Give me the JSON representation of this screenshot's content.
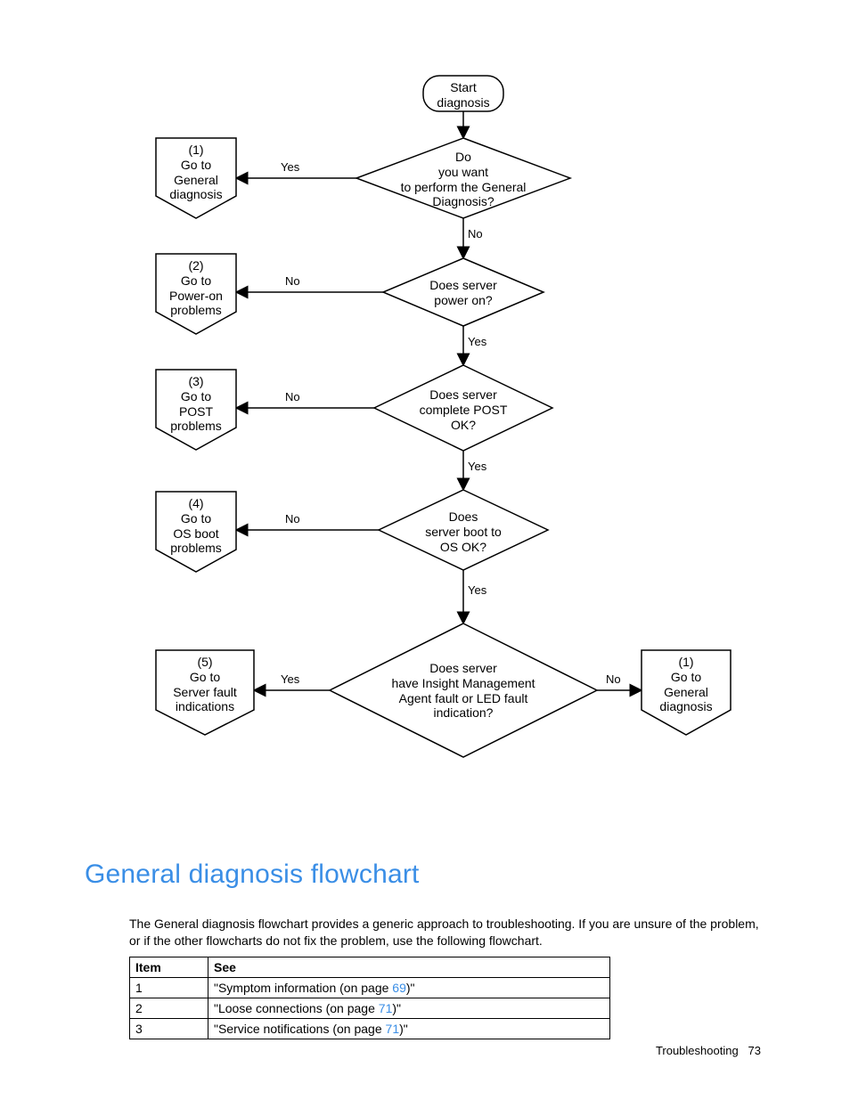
{
  "heading": "General diagnosis flowchart",
  "body_text_1": "The General diagnosis flowchart provides a generic approach to troubleshooting. If you are unsure of the problem, or if the other flowcharts do not fix the problem, use the following flowchart.",
  "footer_section": "Troubleshooting",
  "footer_page": "73",
  "table": {
    "h1": "Item",
    "h2": "See",
    "rows": [
      {
        "item": "1",
        "see_a": "\"Symptom information (on page ",
        "link": "69",
        "see_b": ")\""
      },
      {
        "item": "2",
        "see_a": "\"Loose connections (on page ",
        "link": "71",
        "see_b": ")\""
      },
      {
        "item": "3",
        "see_a": "\"Service notifications (on page ",
        "link": "71",
        "see_b": ")\""
      }
    ]
  },
  "flow": {
    "start": "Start\ndiagnosis",
    "d1": "Do\nyou want\nto perform the General\nDiagnosis?",
    "d2": "Does server\npower on?",
    "d3": "Does server\ncomplete POST\nOK?",
    "d4": "Does\nserver boot to\nOS OK?",
    "d5": "Does server\nhave Insight Management\nAgent fault or LED fault\nindication?",
    "o1": "(1)\nGo to\nGeneral\ndiagnosis",
    "o2": "(2)\nGo to\nPower-on\nproblems",
    "o3": "(3)\nGo to\nPOST\nproblems",
    "o4": "(4)\nGo to\nOS boot\nproblems",
    "o5": "(5)\nGo to\nServer fault\nindications",
    "o1b": "(1)\nGo to\nGeneral\ndiagnosis",
    "yes": "Yes",
    "no": "No"
  },
  "chart_data": {
    "type": "flowchart",
    "nodes": [
      {
        "id": "start",
        "shape": "terminator",
        "text": "Start diagnosis"
      },
      {
        "id": "d1",
        "shape": "decision",
        "text": "Do you want to perform the General Diagnosis?"
      },
      {
        "id": "d2",
        "shape": "decision",
        "text": "Does server power on?"
      },
      {
        "id": "d3",
        "shape": "decision",
        "text": "Does server complete POST OK?"
      },
      {
        "id": "d4",
        "shape": "decision",
        "text": "Does server boot to OS OK?"
      },
      {
        "id": "d5",
        "shape": "decision",
        "text": "Does server have Insight Management Agent fault or LED fault indication?"
      },
      {
        "id": "o1",
        "shape": "offpage",
        "text": "(1) Go to General diagnosis"
      },
      {
        "id": "o2",
        "shape": "offpage",
        "text": "(2) Go to Power-on problems"
      },
      {
        "id": "o3",
        "shape": "offpage",
        "text": "(3) Go to POST problems"
      },
      {
        "id": "o4",
        "shape": "offpage",
        "text": "(4) Go to OS boot problems"
      },
      {
        "id": "o5",
        "shape": "offpage",
        "text": "(5) Go to Server fault indications"
      },
      {
        "id": "o1b",
        "shape": "offpage",
        "text": "(1) Go to General diagnosis"
      }
    ],
    "edges": [
      {
        "from": "start",
        "to": "d1",
        "label": ""
      },
      {
        "from": "d1",
        "to": "o1",
        "label": "Yes"
      },
      {
        "from": "d1",
        "to": "d2",
        "label": "No"
      },
      {
        "from": "d2",
        "to": "o2",
        "label": "No"
      },
      {
        "from": "d2",
        "to": "d3",
        "label": "Yes"
      },
      {
        "from": "d3",
        "to": "o3",
        "label": "No"
      },
      {
        "from": "d3",
        "to": "d4",
        "label": "Yes"
      },
      {
        "from": "d4",
        "to": "o4",
        "label": "No"
      },
      {
        "from": "d4",
        "to": "d5",
        "label": "Yes"
      },
      {
        "from": "d5",
        "to": "o5",
        "label": "Yes"
      },
      {
        "from": "d5",
        "to": "o1b",
        "label": "No"
      }
    ]
  }
}
